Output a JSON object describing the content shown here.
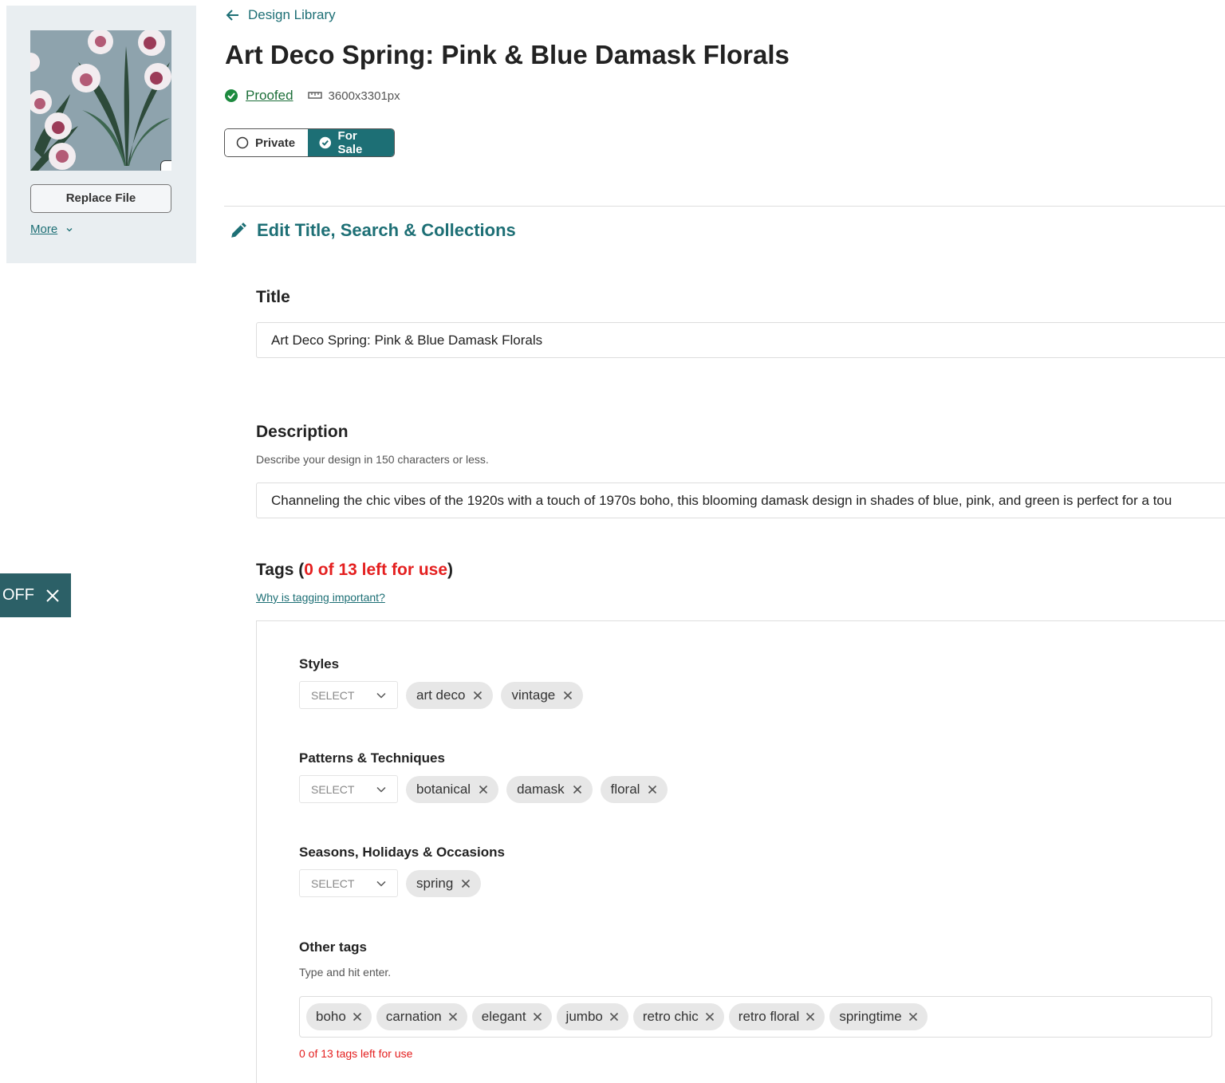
{
  "left_panel": {
    "replace_label": "Replace File",
    "more_label": "More"
  },
  "toast": {
    "label": "OFF"
  },
  "header": {
    "back_label": "Design Library",
    "title": "Art Deco Spring: Pink & Blue Damask Florals",
    "status": "Proofed",
    "dimensions": "3600x3301px"
  },
  "visibility": {
    "private_label": "Private",
    "sale_label": "For Sale",
    "selected": "For Sale"
  },
  "section": {
    "title": "Edit Title, Search & Collections"
  },
  "form": {
    "title_label": "Title",
    "title_value": "Art Deco Spring: Pink & Blue Damask Florals",
    "description_label": "Description",
    "description_help": "Describe your design in 150 characters or less.",
    "description_value": "Channeling the chic vibes of the 1920s with a touch of 1970s boho, this blooming damask design in shades of blue, pink, and green is perfect for a tou"
  },
  "tags": {
    "title_prefix": "Tags (",
    "title_count": "0 of 13 left for use",
    "title_suffix": ")",
    "why_link": "Why is tagging important?",
    "select_placeholder": "SELECT",
    "groups": [
      {
        "label": "Styles",
        "tags": [
          "art deco",
          "vintage"
        ]
      },
      {
        "label": "Patterns & Techniques",
        "tags": [
          "botanical",
          "damask",
          "floral"
        ]
      },
      {
        "label": "Seasons, Holidays & Occasions",
        "tags": [
          "spring"
        ]
      }
    ],
    "other": {
      "label": "Other tags",
      "help": "Type and hit enter.",
      "tags": [
        "boho",
        "carnation",
        "elegant",
        "jumbo",
        "retro chic",
        "retro floral",
        "springtime"
      ],
      "count_note": "0 of 13 tags left for use"
    }
  },
  "colors": {
    "accent": "#1d6f75",
    "warning": "#e41f1f",
    "success": "#1d8a3f",
    "panel_bg": "#e9eef1"
  },
  "icons": {
    "back": "arrow-left-icon",
    "status": "check-circle-icon",
    "dims": "ruler-icon",
    "edit": "pencil-icon",
    "remove": "close-icon",
    "select": "chevron-down-icon"
  }
}
